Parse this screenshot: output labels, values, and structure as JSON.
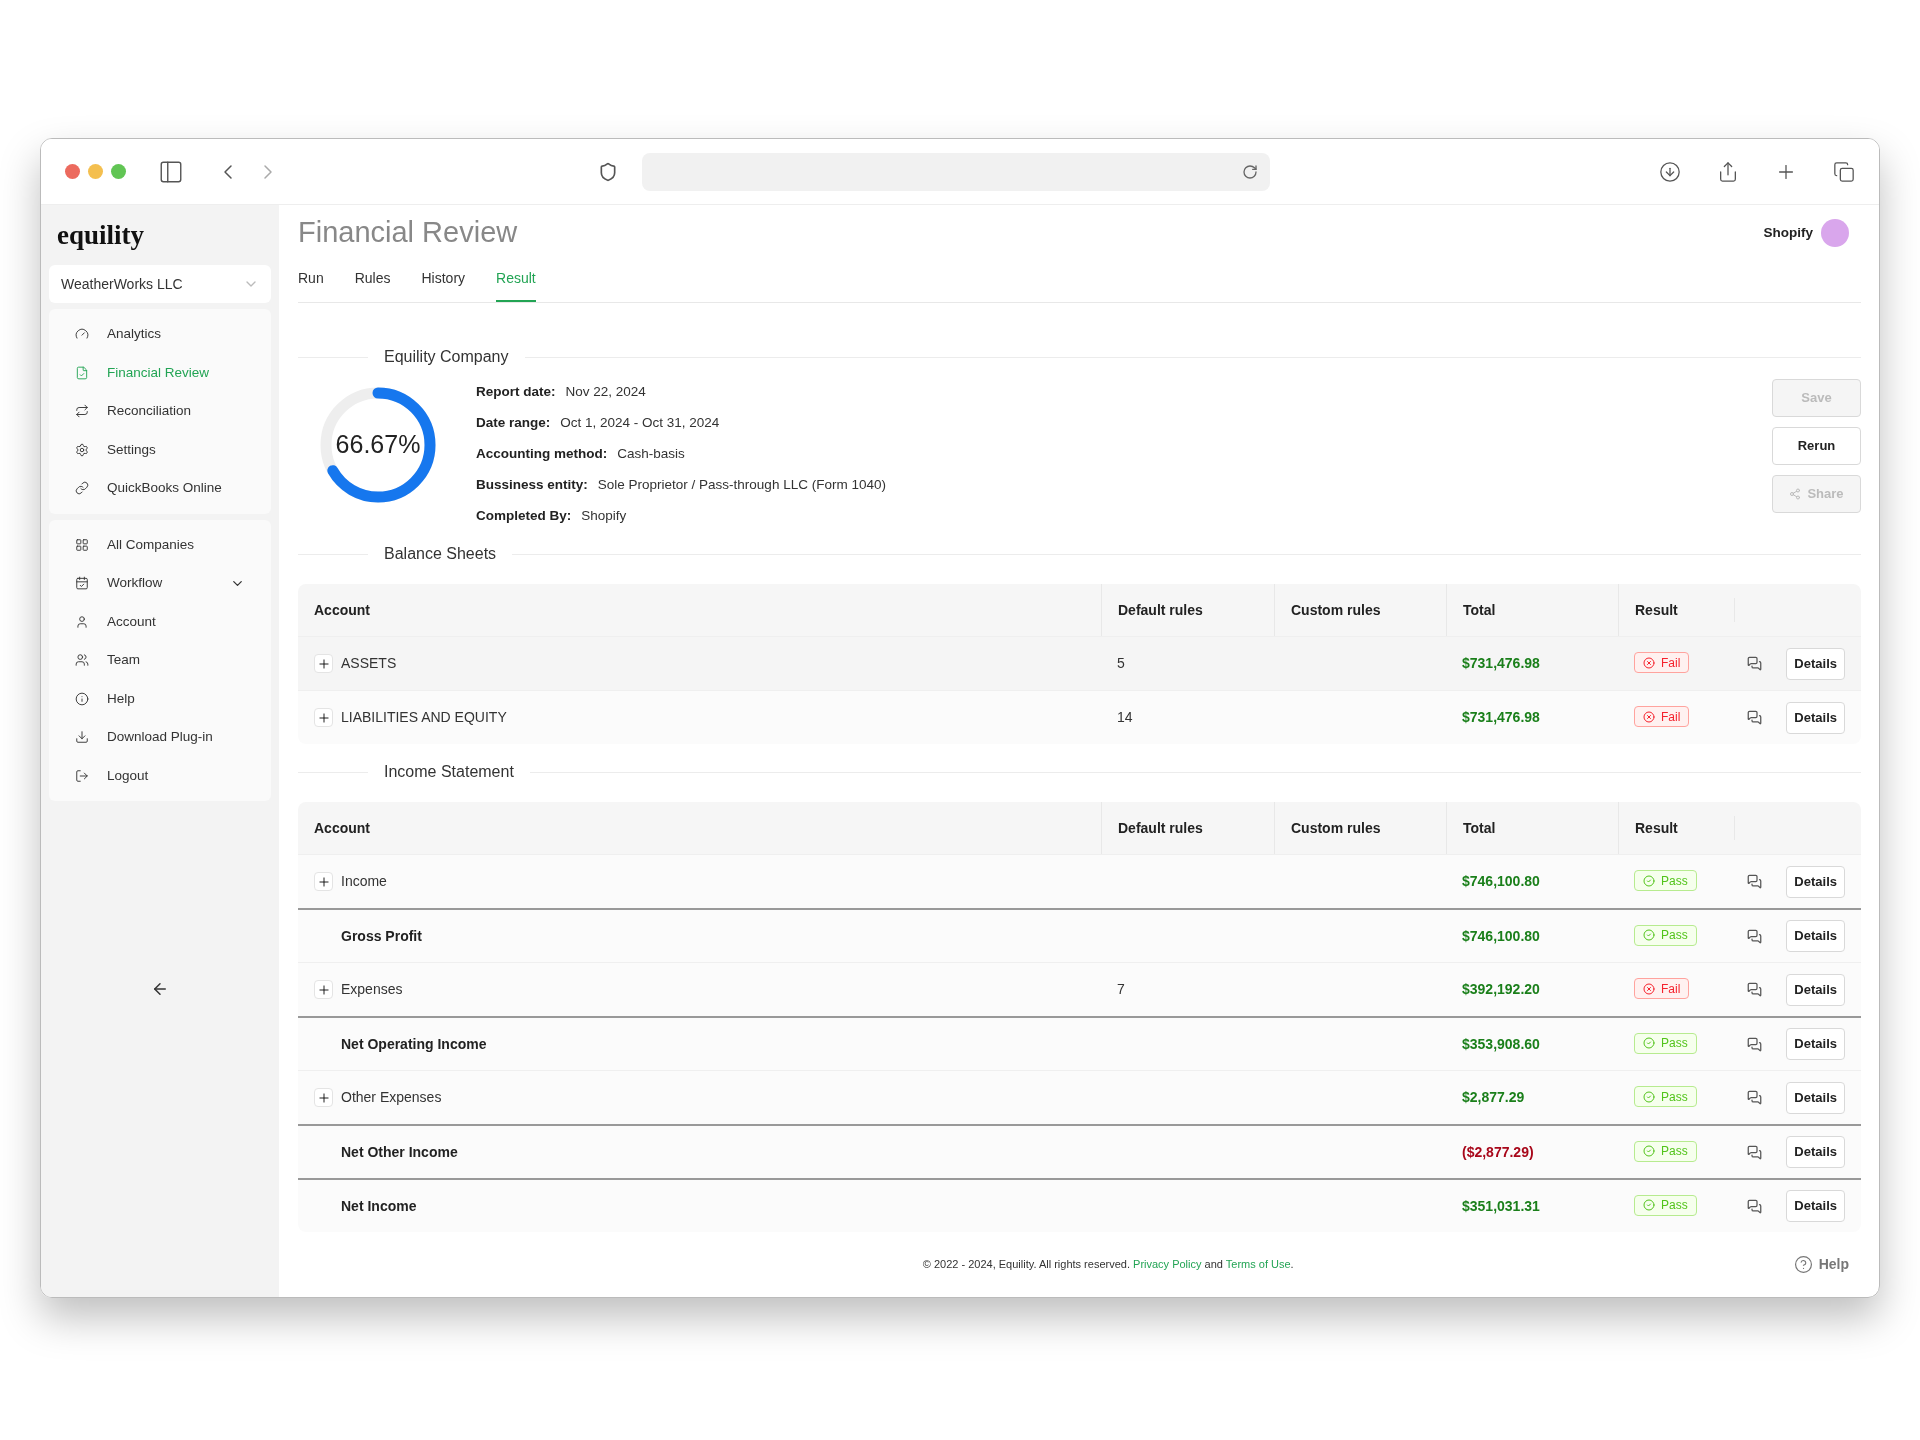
{
  "sidebar": {
    "logo": "equility",
    "company_select": "WeatherWorks LLC",
    "groups": [
      [
        {
          "label": "Analytics",
          "selected": false
        },
        {
          "label": "Financial Review",
          "selected": true
        },
        {
          "label": "Reconciliation",
          "selected": false
        },
        {
          "label": "Settings",
          "selected": false
        },
        {
          "label": "QuickBooks Online",
          "selected": false
        }
      ],
      [
        {
          "label": "All Companies",
          "selected": false
        },
        {
          "label": "Workflow",
          "selected": false,
          "expanded": false
        },
        {
          "label": "Account",
          "selected": false
        },
        {
          "label": "Team",
          "selected": false
        },
        {
          "label": "Help",
          "selected": false
        },
        {
          "label": "Download Plug-in",
          "selected": false
        },
        {
          "label": "Logout",
          "selected": false
        }
      ]
    ]
  },
  "header": {
    "title": "Financial Review",
    "user": "Shopify"
  },
  "tabs": [
    {
      "label": "Run",
      "selected": false
    },
    {
      "label": "Rules",
      "selected": false
    },
    {
      "label": "History",
      "selected": false
    },
    {
      "label": "Result",
      "selected": true
    }
  ],
  "summary": {
    "heading": "Equility Company",
    "score": {
      "label": "66.67%",
      "level": 0.6667
    },
    "fields": [
      {
        "label": "Report date:",
        "value": "Nov 22, 2024"
      },
      {
        "label": "Date range:",
        "value": "Oct 1, 2024 - Oct 31, 2024"
      },
      {
        "label": "Accounting method:",
        "value": "Cash-basis"
      },
      {
        "label": "Bussiness entity:",
        "value": "Sole Proprietor / Pass-through LLC (Form 1040)"
      },
      {
        "label": "Completed By:",
        "value": "Shopify"
      }
    ],
    "buttons": [
      {
        "label": "Save",
        "disabled": true
      },
      {
        "label": "Rerun",
        "disabled": false
      },
      {
        "label": "Share",
        "disabled": true
      }
    ]
  },
  "sections": [
    {
      "heading": "Balance Sheets",
      "columns": [
        "Account",
        "Default rules",
        "Custom rules",
        "Total",
        "Result"
      ],
      "rows": [
        {
          "kind": "group",
          "account": "ASSETS",
          "default_rules": "5",
          "total": "$731,476.98",
          "negative": false,
          "result": "Fail",
          "passed": false,
          "action": "Details"
        },
        {
          "kind": "group",
          "account": "LIABILITIES AND EQUITY",
          "default_rules": "14",
          "total": "$731,476.98",
          "negative": false,
          "result": "Fail",
          "passed": false,
          "action": "Details"
        }
      ]
    },
    {
      "heading": "Income Statement",
      "columns": [
        "Account",
        "Default rules",
        "Custom rules",
        "Total",
        "Result"
      ],
      "rows": [
        {
          "kind": "group",
          "account": "Income",
          "total": "$746,100.80",
          "negative": false,
          "result": "Pass",
          "passed": true,
          "action": "Details"
        },
        {
          "kind": "summary",
          "account": "Gross Profit",
          "total": "$746,100.80",
          "negative": false,
          "result": "Pass",
          "passed": true,
          "action": "Details"
        },
        {
          "kind": "group",
          "account": "Expenses",
          "default_rules": "7",
          "total": "$392,192.20",
          "negative": false,
          "result": "Fail",
          "passed": false,
          "action": "Details"
        },
        {
          "kind": "summary",
          "account": "Net Operating Income",
          "total": "$353,908.60",
          "negative": false,
          "result": "Pass",
          "passed": true,
          "action": "Details"
        },
        {
          "kind": "group",
          "account": "Other Expenses",
          "total": "$2,877.29",
          "negative": false,
          "result": "Pass",
          "passed": true,
          "action": "Details"
        },
        {
          "kind": "summary",
          "account": "Net Other Income",
          "total": "($2,877.29)",
          "negative": true,
          "result": "Pass",
          "passed": true,
          "action": "Details"
        },
        {
          "kind": "summary",
          "account": "Net Income",
          "total": "$351,031.31",
          "negative": false,
          "result": "Pass",
          "passed": true,
          "action": "Details"
        }
      ]
    }
  ],
  "footer": {
    "copyright": "© 2022 - 2024, Equility. All rights reserved.",
    "privacy": "Privacy Policy",
    "and": "and",
    "terms": "Terms of Use",
    "period": ".",
    "help": "Help"
  }
}
